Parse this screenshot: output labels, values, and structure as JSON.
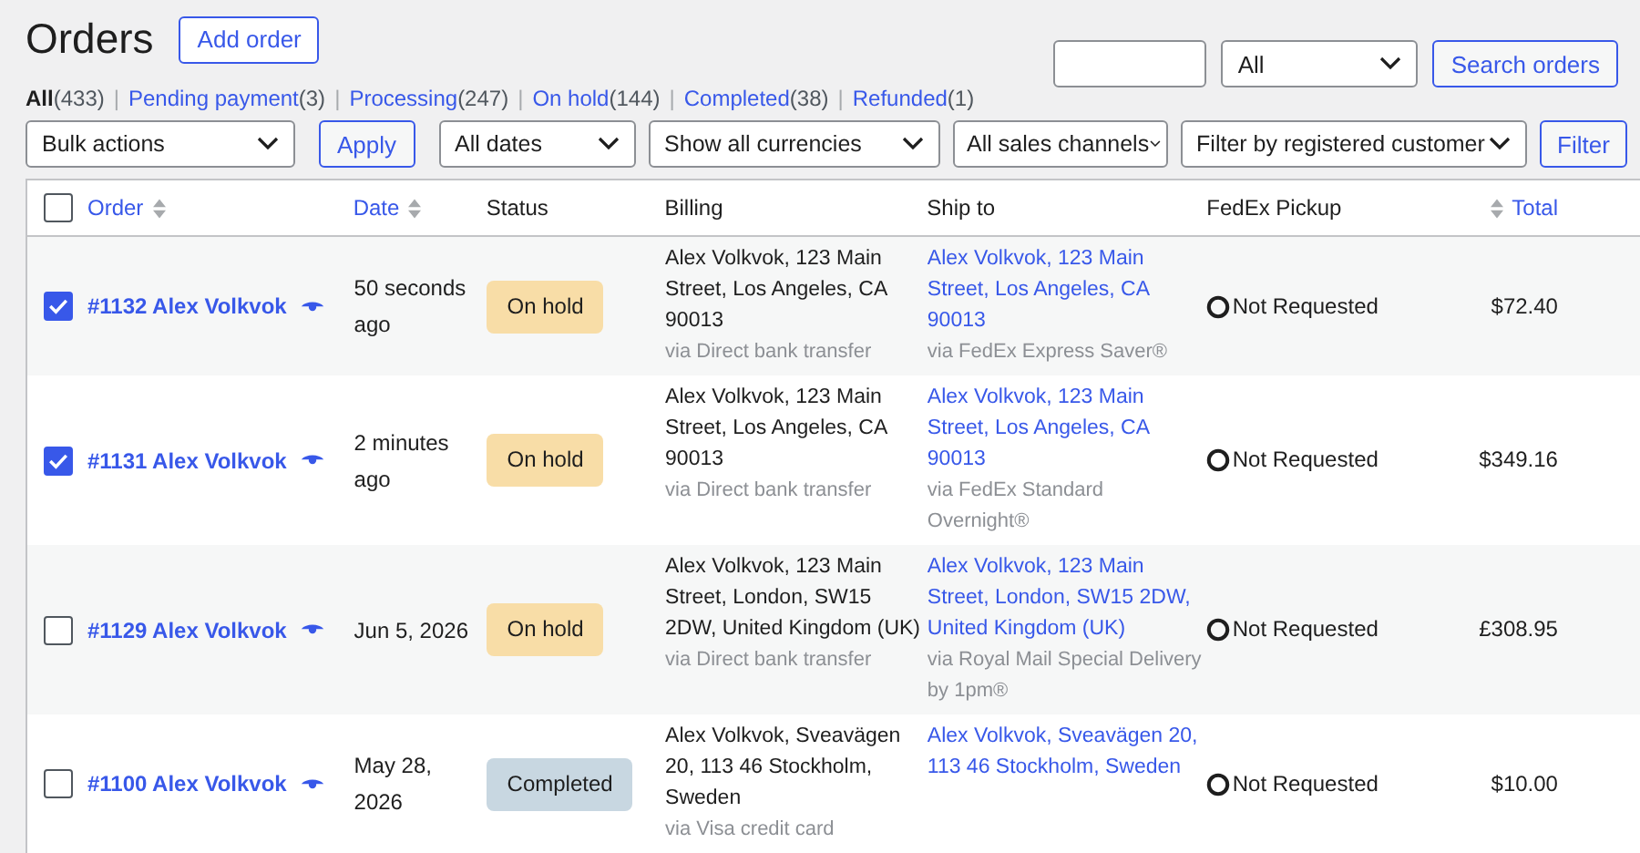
{
  "page_title": "Orders",
  "add_button": "Add order",
  "search": {
    "status_select": "All",
    "button": "Search orders"
  },
  "status_filters": [
    {
      "label": "All",
      "count": "(433)",
      "selected": true
    },
    {
      "separator": "|",
      "label": "Pending payment",
      "count": "(3)",
      "selected": false
    },
    {
      "separator": "|",
      "label": "Processing",
      "count": "(247)",
      "selected": false
    },
    {
      "separator": "|",
      "label": "On hold",
      "count": "(144)",
      "selected": false
    },
    {
      "separator": "|",
      "label": "Completed",
      "count": "(38)",
      "selected": false
    },
    {
      "separator": "|",
      "label": "Refunded",
      "count": "(1)",
      "selected": false
    }
  ],
  "filters": {
    "bulk_actions": "Bulk actions",
    "apply": "Apply",
    "dates": "All dates",
    "currencies": "Show all currencies",
    "channels": "All sales channels",
    "customer": "Filter by registered customer",
    "filter": "Filter"
  },
  "table": {
    "select_all_checked": false,
    "columns": [
      {
        "label": "Order",
        "sortable": true
      },
      {
        "label": "Date",
        "sortable": true
      },
      {
        "label": "Status",
        "sortable": false
      },
      {
        "label": "Billing",
        "sortable": false
      },
      {
        "label": "Ship to",
        "sortable": false
      },
      {
        "label": "FedEx Pickup",
        "sortable": false
      },
      {
        "label": "Total",
        "sortable": true
      }
    ],
    "rows": [
      {
        "checked": true,
        "order": "#1132 Alex Volkvok",
        "date": "50 seconds ago",
        "status": "On hold",
        "color": "#f8dda7",
        "billing": "Alex Volkvok, 123 Main Street, Los Angeles, CA 90013",
        "billing_via": "via Direct bank transfer",
        "ship_to": "Alex Volkvok, 123 Main Street, Los Angeles, CA 90013",
        "ship_via": "via FedEx Express Saver®",
        "fedex": "Not Requested",
        "total": "$72.40"
      },
      {
        "checked": true,
        "order": "#1131 Alex Volkvok",
        "date": "2 minutes ago",
        "status": "On hold",
        "color": "#f8dda7",
        "billing": "Alex Volkvok, 123 Main Street, Los Angeles, CA 90013",
        "billing_via": "via Direct bank transfer",
        "ship_to": "Alex Volkvok, 123 Main Street, Los Angeles, CA 90013",
        "ship_via": "via FedEx Standard Overnight®",
        "fedex": "Not Requested",
        "total": "$349.16"
      },
      {
        "checked": false,
        "order": "#1129 Alex Volkvok",
        "date": "Jun 5, 2026",
        "status": "On hold",
        "color": "#f8dda7",
        "billing": "Alex Volkvok, 123 Main Street, London, SW15 2DW, United Kingdom (UK)",
        "billing_via": "via Direct bank transfer",
        "ship_to": "Alex Volkvok, 123 Main Street, London, SW15 2DW, United Kingdom (UK)",
        "ship_via": "via Royal Mail Special Delivery by 1pm®",
        "fedex": "Not Requested",
        "total": "£308.95"
      },
      {
        "checked": false,
        "order": "#1100 Alex Volkvok",
        "date": "May 28, 2026",
        "status": "Completed",
        "color": "#c8d7e1",
        "billing": "Alex Volkvok, Sveavägen 20, 113 46 Stockholm, Sweden",
        "billing_via": "via Visa credit card",
        "ship_to": "Alex Volkvok, Sveavägen 20, 113 46 Stockholm, Sweden",
        "fedex": "Not Requested",
        "total": "$10.00"
      }
    ]
  }
}
